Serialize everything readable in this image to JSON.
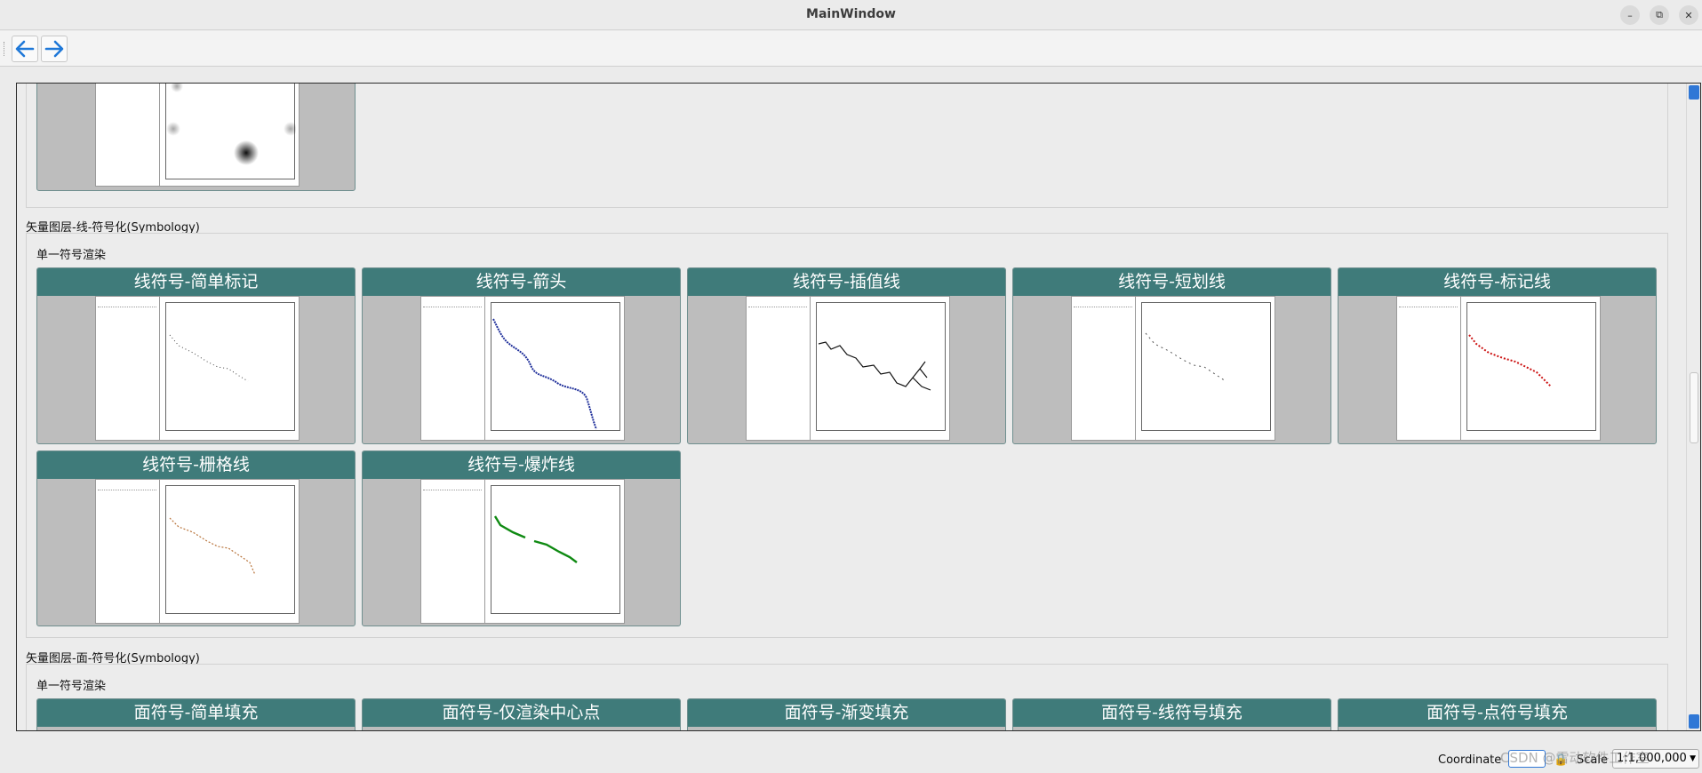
{
  "window": {
    "title": "MainWindow"
  },
  "toolbar": {
    "back_label": "back",
    "forward_label": "forward"
  },
  "sections": {
    "line": {
      "title": "矢量图层-线-符号化(Symbology)",
      "subtitle": "单一符号渲染",
      "cards": [
        "线符号-简单标记",
        "线符号-箭头",
        "线符号-插值线",
        "线符号-短划线",
        "线符号-标记线",
        "线符号-栅格线",
        "线符号-爆炸线"
      ]
    },
    "polygon": {
      "title": "矢量图层-面-符号化(Symbology)",
      "subtitle": "单一符号渲染",
      "cards": [
        "面符号-简单填充",
        "面符号-仅渲染中心点",
        "面符号-渐变填充",
        "面符号-线符号填充",
        "面符号-点符号填充"
      ]
    }
  },
  "statusbar": {
    "coordinate_label": "Coordinate",
    "scale_label": "Scale",
    "scale_value": "1:1,000,000"
  },
  "watermark": "CSDN @雷动软件工作室",
  "colors": {
    "card_header": "#3f7b7a",
    "accent": "#2f77d6",
    "line_blue": "#1f2f9a",
    "line_red": "#cc1111",
    "line_green": "#0f8a12",
    "line_brown": "#b8733a"
  }
}
